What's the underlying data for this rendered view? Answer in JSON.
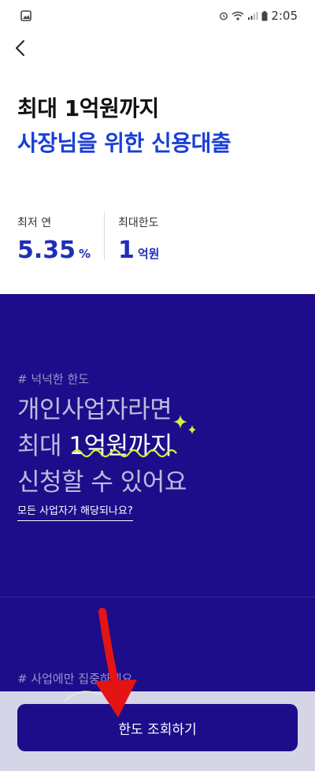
{
  "status_bar": {
    "time": "2:05",
    "icons": [
      "gallery-icon",
      "alarm-icon",
      "wifi-icon",
      "signal-icon",
      "battery-icon"
    ]
  },
  "header": {
    "title_line1": "최대 1억원까지",
    "title_line2": "사장님을 위한 신용대출"
  },
  "stats": [
    {
      "label": "최저 연",
      "value": "5.35",
      "unit": "%"
    },
    {
      "label": "최대한도",
      "value": "1",
      "unit": "억원"
    }
  ],
  "panel": {
    "tag1": "# 넉넉한 한도",
    "promo_line1": "개인사업자라면",
    "promo_line2_prefix": "최대 ",
    "promo_line2_highlight": "1억원까지",
    "promo_line3": "신청할 수 있어요",
    "link_text": "모든 사업자가 해당되나요?",
    "tag2": "# 사업에만 집중하세요"
  },
  "cta": {
    "label": "한도 조회하기"
  },
  "colors": {
    "accent_blue": "#1a3fd6",
    "stat_blue": "#1f2fb8",
    "panel_bg": "#1d0d8a",
    "squiggle": "#d6f03a",
    "annotation_red": "#e51414"
  }
}
